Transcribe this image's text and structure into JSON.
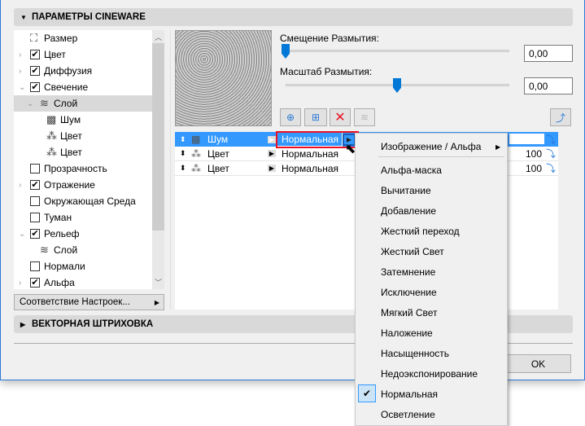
{
  "sections": {
    "cineware": "ПАРАМЕТРЫ CINEWARE",
    "vector": "ВЕКТОРНАЯ ШТРИХОВКА"
  },
  "tree": [
    {
      "label": "Размер",
      "checked": null
    },
    {
      "label": "Цвет",
      "checked": true
    },
    {
      "label": "Диффузия",
      "checked": true
    },
    {
      "label": "Свечение",
      "checked": true
    },
    {
      "label": "Слой",
      "checked": null
    },
    {
      "label": "Шум",
      "checked": null
    },
    {
      "label": "Цвет",
      "checked": null
    },
    {
      "label": "Цвет",
      "checked": null
    },
    {
      "label": "Прозрачность",
      "checked": false
    },
    {
      "label": "Отражение",
      "checked": true
    },
    {
      "label": "Окружающая Среда",
      "checked": false
    },
    {
      "label": "Туман",
      "checked": false
    },
    {
      "label": "Рельеф",
      "checked": true
    },
    {
      "label": "Слой",
      "checked": null
    },
    {
      "label": "Нормали",
      "checked": false
    },
    {
      "label": "Альфа",
      "checked": true
    }
  ],
  "match_button": "Соответствие Настроек...",
  "blur_offset": {
    "label": "Смещение Размытия:",
    "value": "0,00",
    "slider": 0.0
  },
  "blur_scale": {
    "label": "Масштаб Размытия:",
    "value": "0,00",
    "slider": 0.5
  },
  "layers": [
    {
      "name": "Шум",
      "mode": "Нормальная",
      "opacity": ""
    },
    {
      "name": "Цвет",
      "mode": "Нормальная",
      "opacity": "100"
    },
    {
      "name": "Цвет",
      "mode": "Нормальная",
      "opacity": "100"
    }
  ],
  "menu": {
    "submenu": "Изображение / Альфа",
    "items": [
      "Альфа-маска",
      "Вычитание",
      "Добавление",
      "Жесткий переход",
      "Жесткий Свет",
      "Затемнение",
      "Исключение",
      "Мягкий Свет",
      "Наложение",
      "Насыщенность",
      "Недоэкспонирование",
      "Нормальная",
      "Осветление"
    ],
    "checked": "Нормальная"
  },
  "ok": "OK",
  "colors": {
    "accent": "#3399ff",
    "delete": "#e81123"
  }
}
